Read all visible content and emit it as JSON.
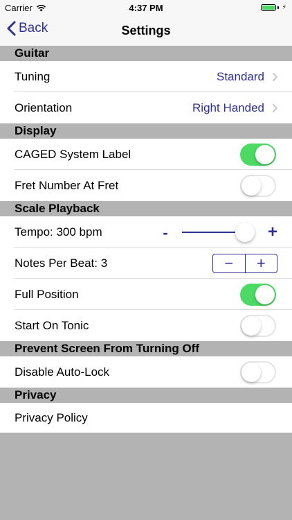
{
  "status": {
    "carrier": "Carrier",
    "time": "4:37 PM",
    "battery_color": "#4cd964"
  },
  "nav": {
    "back_label": "Back",
    "title": "Settings"
  },
  "accent_color": "#2e3192",
  "sections": {
    "guitar": {
      "header": "Guitar",
      "tuning": {
        "label": "Tuning",
        "value": "Standard"
      },
      "orientation": {
        "label": "Orientation",
        "value": "Right Handed"
      }
    },
    "display": {
      "header": "Display",
      "caged": {
        "label": "CAGED System Label",
        "on": true
      },
      "fret_number": {
        "label": "Fret Number At Fret",
        "on": false
      }
    },
    "playback": {
      "header": "Scale Playback",
      "tempo": {
        "label": "Tempo: 300 bpm",
        "minus": "-",
        "plus": "+",
        "level": 0.9
      },
      "notes": {
        "label": "Notes Per Beat: 3",
        "minus": "−",
        "plus": "+"
      },
      "full_position": {
        "label": "Full Position",
        "on": true
      },
      "start_tonic": {
        "label": "Start On Tonic",
        "on": false
      }
    },
    "screen": {
      "header": "Prevent Screen From Turning Off",
      "auto_lock": {
        "label": "Disable Auto-Lock",
        "on": false
      }
    },
    "privacy": {
      "header": "Privacy",
      "policy": {
        "label": "Privacy Policy"
      }
    }
  }
}
